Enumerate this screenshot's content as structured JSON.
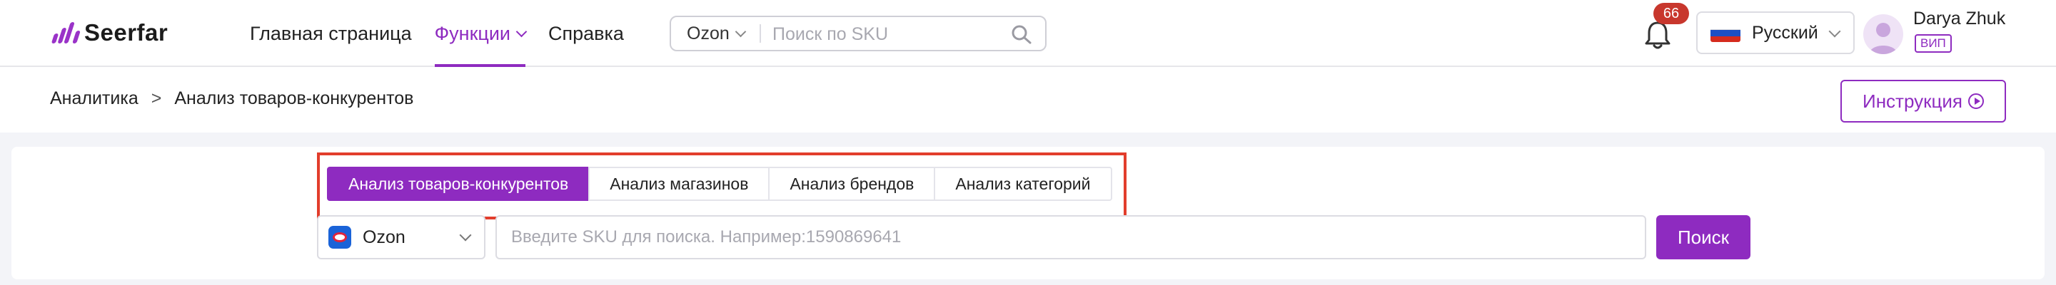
{
  "brand": {
    "name": "Seerfar"
  },
  "nav": {
    "items": [
      {
        "label": "Главная страница",
        "active": false,
        "dropdown": false
      },
      {
        "label": "Функции",
        "active": true,
        "dropdown": true
      },
      {
        "label": "Справка",
        "active": false,
        "dropdown": false
      }
    ]
  },
  "header_search": {
    "platform": "Ozon",
    "placeholder": "Поиск по SKU",
    "icon": "search-icon"
  },
  "notifications": {
    "count": "66",
    "icon": "bell-icon"
  },
  "language": {
    "label": "Русский",
    "flag": "russia-flag"
  },
  "user": {
    "name": "Darya Zhuk",
    "badge": "ВИП"
  },
  "breadcrumb": {
    "items": [
      "Аналитика",
      "Анализ товаров-конкурентов"
    ],
    "separator": ">"
  },
  "instruction_button": {
    "label": "Инструкция",
    "icon": "play-circle-icon"
  },
  "tabs": [
    {
      "label": "Анализ товаров-конкурентов",
      "active": true
    },
    {
      "label": "Анализ магазинов",
      "active": false
    },
    {
      "label": "Анализ брендов",
      "active": false
    },
    {
      "label": "Анализ категорий",
      "active": false
    }
  ],
  "search_form": {
    "platform": "Ozon",
    "placeholder": "Введите SKU для поиска. Например:1590869641",
    "button_label": "Поиск"
  },
  "colors": {
    "accent": "#8e2bc0",
    "highlight": "#e23d2c",
    "badge": "#c8372d"
  }
}
